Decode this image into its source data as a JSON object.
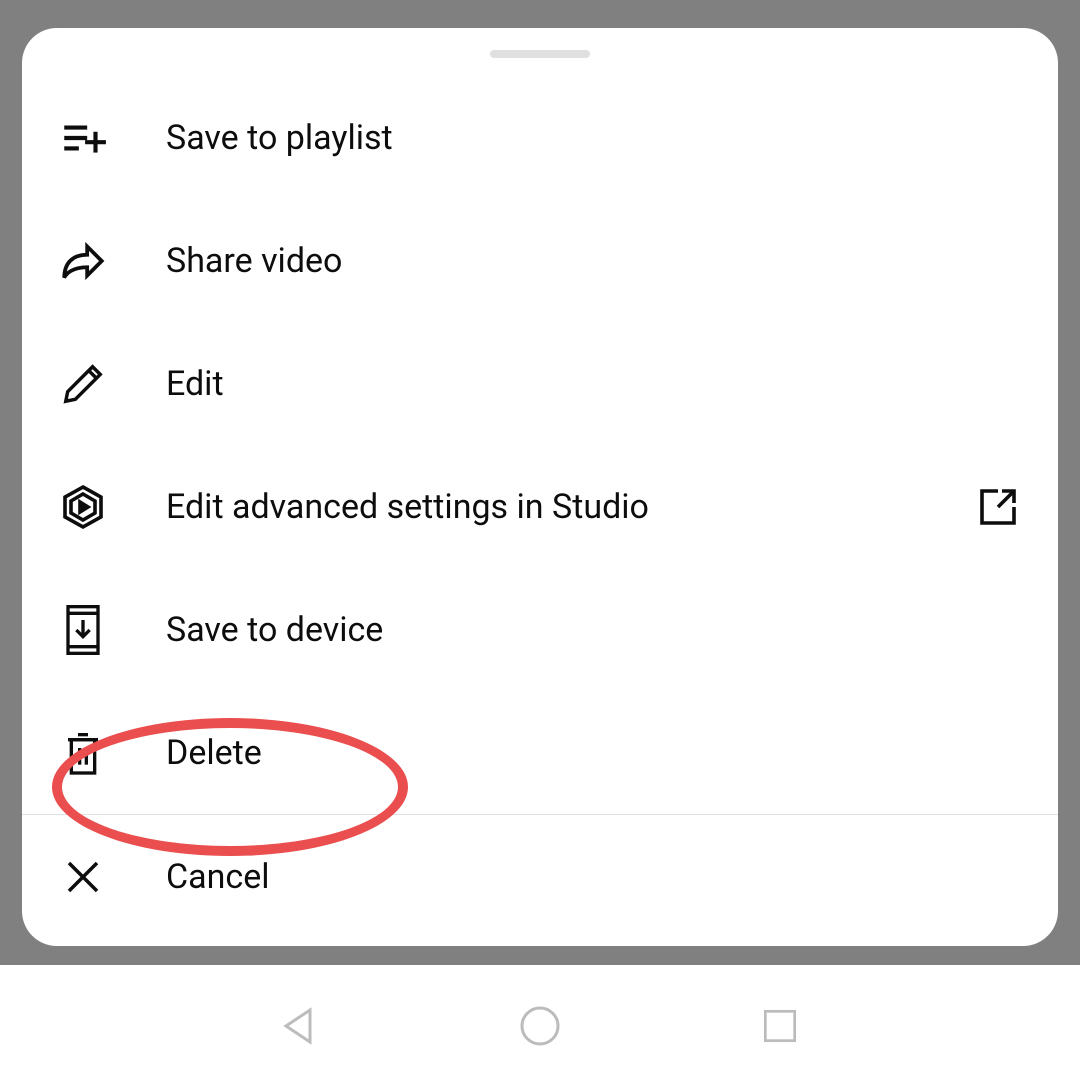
{
  "menu": {
    "savePlaylist": "Save to playlist",
    "shareVideo": "Share video",
    "edit": "Edit",
    "editAdvanced": "Edit advanced settings in Studio",
    "saveDevice": "Save to device",
    "delete": "Delete",
    "cancel": "Cancel"
  },
  "highlightedItem": "delete"
}
